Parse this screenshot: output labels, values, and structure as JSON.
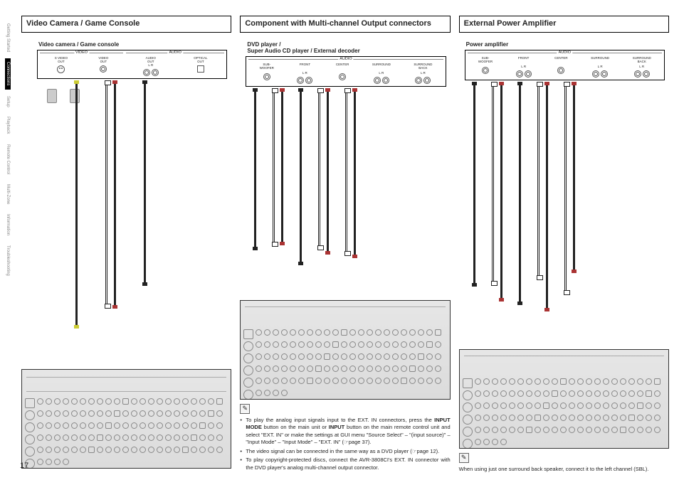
{
  "page_number": "17",
  "sidebar": {
    "items": [
      {
        "label": "Getting Started"
      },
      {
        "label": "Connections"
      },
      {
        "label": "Setup"
      },
      {
        "label": "Playback"
      },
      {
        "label": "Remote Control"
      },
      {
        "label": "Multi-Zone"
      },
      {
        "label": "Information"
      },
      {
        "label": "Troubleshooting"
      }
    ],
    "active_index": 1
  },
  "columns": {
    "video_game": {
      "title": "Video Camera / Game Console",
      "device_label": "Video camera / Game console",
      "groups": {
        "video": {
          "title": "VIDEO",
          "ports": [
            {
              "label_top": "S VIDEO",
              "label_bottom": "OUT"
            },
            {
              "label_top": "VIDEO",
              "label_bottom": "OUT"
            }
          ]
        },
        "audio": {
          "title": "AUDIO",
          "ports": [
            {
              "label_top": "AUDIO",
              "label_bottom": "OUT",
              "lr": "L  R"
            },
            {
              "label_top": "OPTICAL",
              "label_bottom": "OUT"
            }
          ]
        }
      }
    },
    "multichannel": {
      "title": "Component with Multi-channel Output connectors",
      "device_label": "DVD player /\nSuper Audio CD player / External decoder",
      "audio_title": "AUDIO",
      "channels": [
        {
          "name": "SUB-\nWOOFER",
          "lr": ""
        },
        {
          "name": "FRONT",
          "lr": "L  R"
        },
        {
          "name": "CENTER",
          "lr": ""
        },
        {
          "name": "SURROUND",
          "lr": "L  R"
        },
        {
          "name": "SURROUND\nBACK",
          "lr": "L  R"
        }
      ],
      "notes": [
        "To play the analog input signals input to the EXT. IN connectors, press the <b>INPUT MODE</b> button on the main unit or <b>INPUT</b> button on the main remote control unit and select \"EXT. IN\" or make the settings at GUI menu \"Source Select\" – \"(input source)\" – \"Input Mode\" – \"Input Mode\" – \"EXT. IN\" (☞page 37).",
        "The video signal can be connected in the same way as a DVD player (☞page 12).",
        "To play copyright-protected discs, connect the AVR-3808CI's EXT. IN connector with the DVD player's analog multi-channel output connector."
      ]
    },
    "poweramp": {
      "title": "External Power Amplifier",
      "device_label": "Power amplifier",
      "audio_title": "AUDIO",
      "channels": [
        {
          "name": "SUB-\nWOOFER",
          "lr": ""
        },
        {
          "name": "FRONT",
          "lr": "L  R"
        },
        {
          "name": "CENTER",
          "lr": ""
        },
        {
          "name": "SURROUND",
          "lr": "L  R"
        },
        {
          "name": "SURROUND\nBACK",
          "lr": "L  R"
        }
      ],
      "note_text": "When using just one surround back speaker, connect it to the left channel (SBL)."
    }
  }
}
